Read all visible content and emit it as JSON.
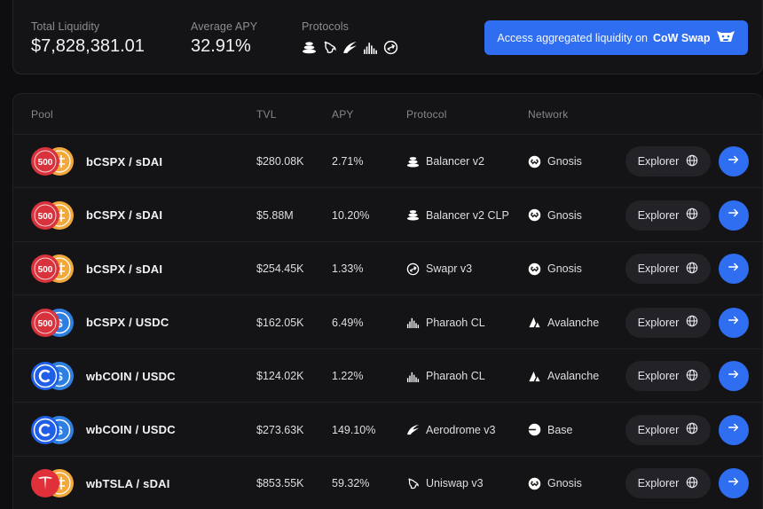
{
  "stats": {
    "liquidity": {
      "label": "Total Liquidity",
      "value": "$7,828,381.01"
    },
    "apy": {
      "label": "Average APY",
      "value": "32.91%"
    },
    "protocols": {
      "label": "Protocols",
      "icons": [
        "balancer-icon",
        "uniswap-icon",
        "aerodrome-icon",
        "pharaoh-icon",
        "swapr-icon"
      ]
    }
  },
  "cow_button": {
    "prefix": "Access aggregated liquidity on",
    "brand": "CoW Swap",
    "icon": "cow-icon"
  },
  "table": {
    "headers": {
      "pool": "Pool",
      "tvl": "TVL",
      "apy": "APY",
      "protocol": "Protocol",
      "network": "Network"
    },
    "explorer_label": "Explorer",
    "rows": [
      {
        "tokens": [
          "spx500",
          "sdai"
        ],
        "pair": "bCSPX / sDAI",
        "tvl": "$280.08K",
        "apy": "2.71%",
        "protocol": "Balancer v2",
        "protocol_icon": "balancer-icon",
        "network": "Gnosis",
        "network_icon": "gnosis-icon"
      },
      {
        "tokens": [
          "spx500",
          "sdai"
        ],
        "pair": "bCSPX / sDAI",
        "tvl": "$5.88M",
        "apy": "10.20%",
        "protocol": "Balancer v2 CLP",
        "protocol_icon": "balancer-icon",
        "network": "Gnosis",
        "network_icon": "gnosis-icon"
      },
      {
        "tokens": [
          "spx500",
          "sdai"
        ],
        "pair": "bCSPX / sDAI",
        "tvl": "$254.45K",
        "apy": "1.33%",
        "protocol": "Swapr v3",
        "protocol_icon": "swapr-icon",
        "network": "Gnosis",
        "network_icon": "gnosis-icon"
      },
      {
        "tokens": [
          "spx500",
          "usdc"
        ],
        "pair": "bCSPX / USDC",
        "tvl": "$162.05K",
        "apy": "6.49%",
        "protocol": "Pharaoh CL",
        "protocol_icon": "pharaoh-icon",
        "network": "Avalanche",
        "network_icon": "avalanche-icon"
      },
      {
        "tokens": [
          "coin",
          "usdc"
        ],
        "pair": "wbCOIN / USDC",
        "tvl": "$124.02K",
        "apy": "1.22%",
        "protocol": "Pharaoh CL",
        "protocol_icon": "pharaoh-icon",
        "network": "Avalanche",
        "network_icon": "avalanche-icon"
      },
      {
        "tokens": [
          "coin",
          "usdc"
        ],
        "pair": "wbCOIN / USDC",
        "tvl": "$273.63K",
        "apy": "149.10%",
        "protocol": "Aerodrome v3",
        "protocol_icon": "aerodrome-icon",
        "network": "Base",
        "network_icon": "base-icon"
      },
      {
        "tokens": [
          "tsla",
          "sdai"
        ],
        "pair": "wbTSLA / sDAI",
        "tvl": "$853.55K",
        "apy": "59.32%",
        "protocol": "Uniswap v3",
        "protocol_icon": "uniswap-icon",
        "network": "Gnosis",
        "network_icon": "gnosis-icon"
      }
    ]
  },
  "colors": {
    "accent": "#2f6ef0",
    "spx": "#d8323c",
    "sdai": "#f2a93b",
    "usdc": "#2f7fe0",
    "coin": "#1f5fe8",
    "tsla": "#e0303a"
  }
}
